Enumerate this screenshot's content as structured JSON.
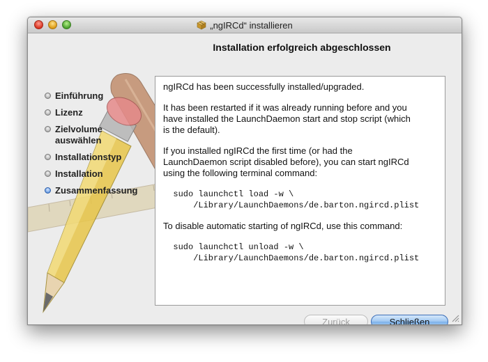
{
  "window": {
    "title": "„ngIRCd“ installieren"
  },
  "heading": "Installation erfolgreich abgeschlossen",
  "steps": [
    {
      "label": "Einführung",
      "active": false
    },
    {
      "label": "Lizenz",
      "active": false
    },
    {
      "label": "Zielvolume\nauswählen",
      "active": false
    },
    {
      "label": "Installationstyp",
      "active": false
    },
    {
      "label": "Installation",
      "active": false
    },
    {
      "label": "Zusammenfassung",
      "active": true
    }
  ],
  "message": {
    "p1": "ngIRCd has been successfully installed/upgraded.",
    "p2": "It has been restarted if it was already running before and you\nhave installed the LaunchDaemon start and stop script (which\nis the default).",
    "p3": "If you installed ngIRCd the first time (or had the\nLaunchDaemon script disabled before), you can start ngIRCd\nusing the following terminal command:",
    "cmd1": "  sudo launchctl load -w \\\n      /Library/LaunchDaemons/de.barton.ngircd.plist",
    "p4": "To disable automatic starting of ngIRCd, use this command:",
    "cmd2": "  sudo launchctl unload -w \\\n      /Library/LaunchDaemons/de.barton.ngircd.plist"
  },
  "buttons": {
    "back_label": "Zurück",
    "close_label": "Schließen"
  },
  "icons": {
    "title_icon": "package-icon",
    "background_art": "pencil-ruler-icon"
  }
}
